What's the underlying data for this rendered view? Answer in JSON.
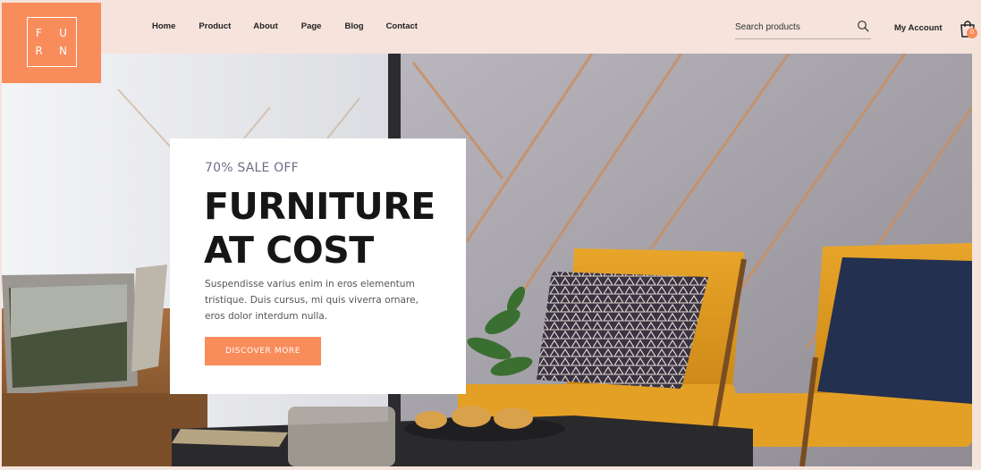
{
  "brand": {
    "logo_letters": [
      "F",
      "U",
      "R",
      "N"
    ],
    "accent_color": "#f98c5b"
  },
  "nav": {
    "items": [
      "Home",
      "Product",
      "About",
      "Page",
      "Blog",
      "Contact"
    ]
  },
  "search": {
    "placeholder": "Search products",
    "icon": "search-icon"
  },
  "account": {
    "label": "My Account"
  },
  "cart": {
    "icon": "shopping-bag-icon",
    "count": "0"
  },
  "hero": {
    "kicker": "70% SALE OFF",
    "headline_line1": "FURNITURE",
    "headline_line2": "AT COST",
    "body": "Suspendisse varius enim in eros elementum tristique. Duis cursus, mi quis viverra ornare, eros dolor interdum nulla.",
    "cta": "DISCOVER MORE"
  }
}
